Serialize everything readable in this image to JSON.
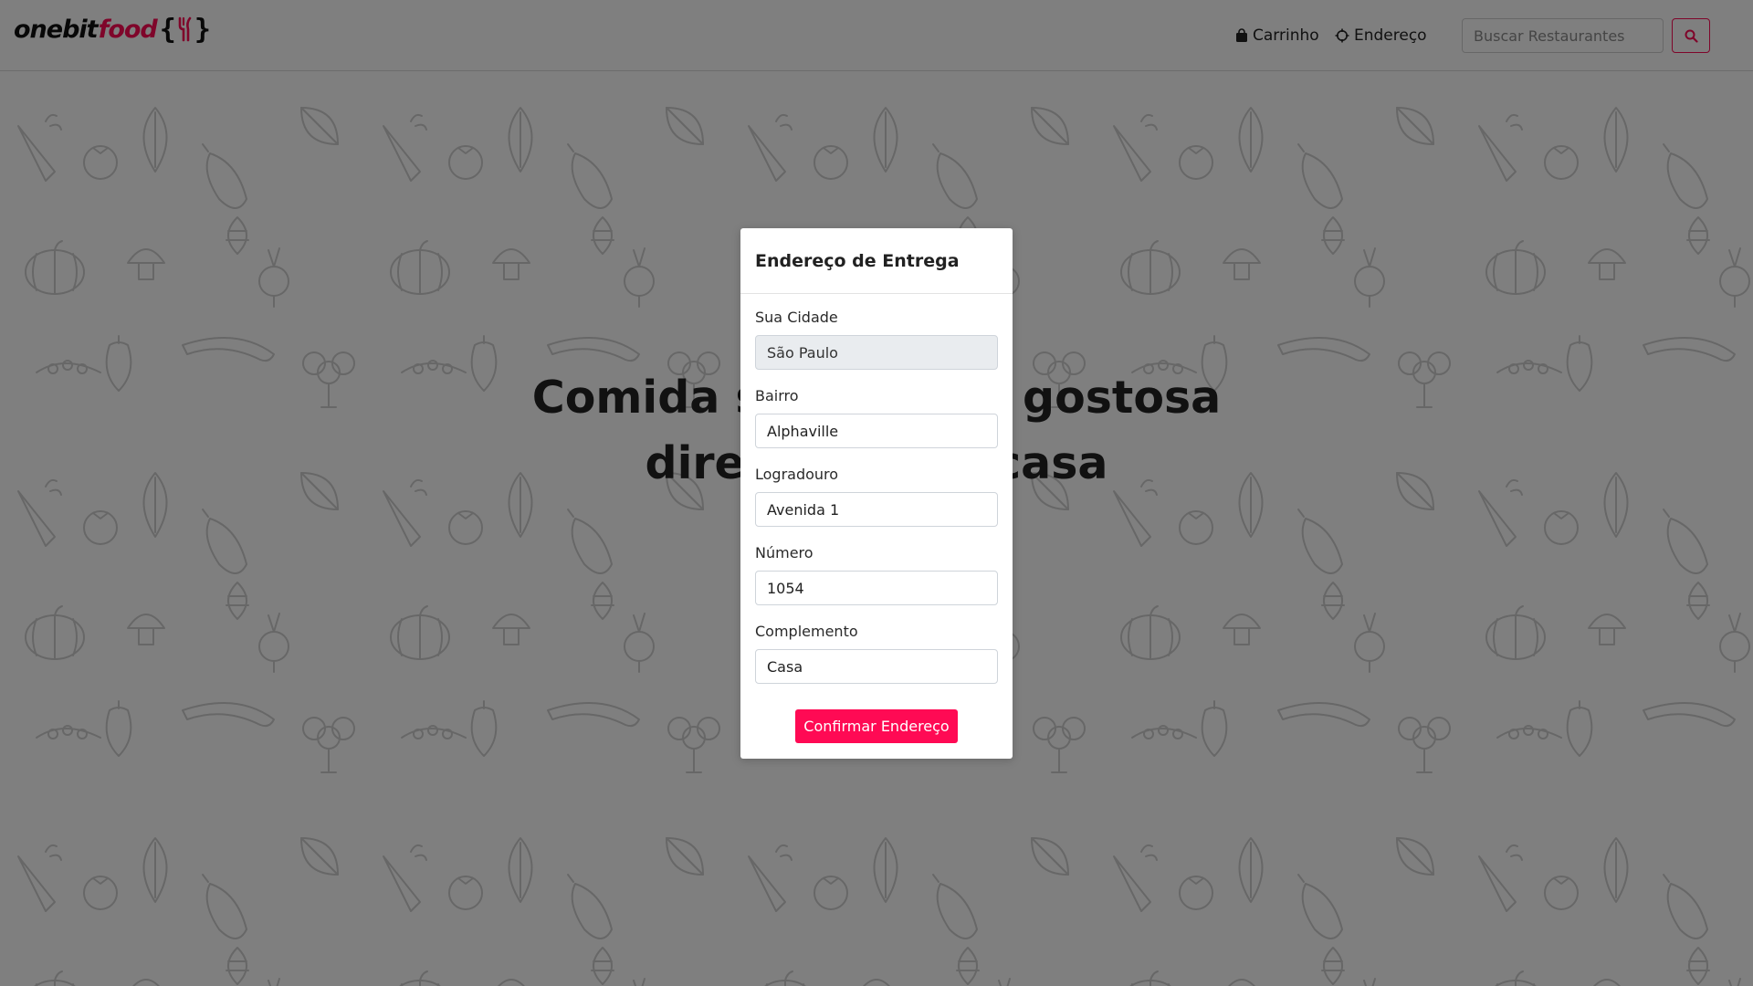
{
  "logo": {
    "part1": "onebit",
    "part2": "food",
    "brace_open": "{",
    "brace_close": "}"
  },
  "nav": {
    "cart_label": "Carrinho",
    "address_label": "Endereço",
    "search_placeholder": "Buscar Restaurantes"
  },
  "hero": {
    "title_line1": "Comida saudável e gostosa",
    "title_line2": "direto na sua casa"
  },
  "modal": {
    "title": "Endereço de Entrega",
    "fields": [
      {
        "label": "Sua Cidade",
        "value": "São Paulo",
        "disabled": true
      },
      {
        "label": "Bairro",
        "value": "Alphaville"
      },
      {
        "label": "Logradouro",
        "value": "Avenida 1"
      },
      {
        "label": "Número",
        "value": "1054"
      },
      {
        "label": "Complemento",
        "value": "Casa"
      }
    ],
    "confirm_label": "Confirmar Endereço"
  },
  "colors": {
    "brand": "#ff0a54",
    "backdrop": "rgba(0,0,0,0.5)",
    "pattern_stroke": "#cfcfcf"
  }
}
